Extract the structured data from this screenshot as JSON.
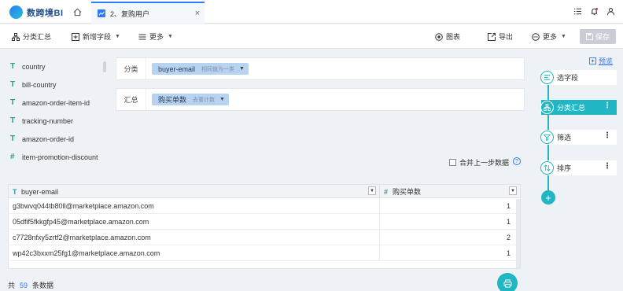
{
  "app": {
    "name": "数跨境BI"
  },
  "tab": {
    "label": "2、复购用户"
  },
  "toolbar": {
    "classify": "分类汇总",
    "new_field": "新增字段",
    "more": "更多",
    "chart": "图表",
    "export": "导出",
    "more2": "更多",
    "save": "保存"
  },
  "fields": [
    {
      "type": "T",
      "name": "country"
    },
    {
      "type": "T",
      "name": "bill-country"
    },
    {
      "type": "T",
      "name": "amazon-order-item-id"
    },
    {
      "type": "T",
      "name": "tracking-number"
    },
    {
      "type": "T",
      "name": "amazon-order-id"
    },
    {
      "type": "#",
      "name": "item-promotion-discount"
    }
  ],
  "config": {
    "group_label": "分类",
    "group_chip": "buyer-email",
    "group_chip_sub": "相同值为一类",
    "agg_label": "汇总",
    "agg_chip": "购买单数",
    "agg_chip_sub": "去重计数"
  },
  "merge_label": "合并上一步数据",
  "help": "?",
  "table": {
    "columns": [
      {
        "type": "T",
        "name": "buyer-email"
      },
      {
        "type": "#",
        "name": "购买单数"
      }
    ],
    "rows": [
      [
        "g3bwvq044tb80ll@marketplace.amazon.com",
        "1"
      ],
      [
        "05dfif5fkkgfp45@marketplace.amazon.com",
        "1"
      ],
      [
        "c7728nfxy5zrtf2@marketplace.amazon.com",
        "2"
      ],
      [
        "wp42c3bxxm25fg1@marketplace.amazon.com",
        "1"
      ]
    ]
  },
  "footer": {
    "prefix": "共",
    "count": "59",
    "suffix": "条数据"
  },
  "flow": {
    "preview": "预览",
    "steps": [
      {
        "label": "选字段",
        "active": false
      },
      {
        "label": "分类汇总",
        "active": true
      },
      {
        "label": "筛选",
        "active": false
      },
      {
        "label": "排序",
        "active": false
      }
    ],
    "add": "+"
  },
  "colors": {
    "accent": "#20b6c4",
    "link": "#2f7bf5",
    "chip": "#b8d3f1"
  }
}
